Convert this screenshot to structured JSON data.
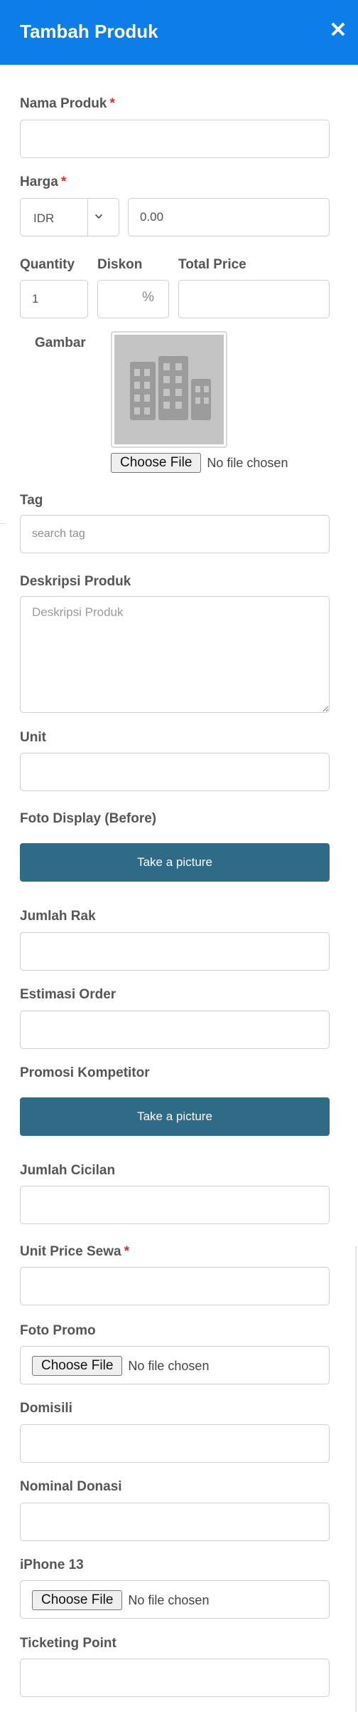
{
  "header": {
    "title": "Tambah Produk",
    "close_icon": "close-icon"
  },
  "form": {
    "nama_produk": {
      "label": "Nama Produk",
      "required_mark": "*",
      "value": ""
    },
    "harga": {
      "label": "Harga",
      "required_mark": "*",
      "currency": "IDR",
      "value": "0.00"
    },
    "quantity": {
      "label": "Quantity",
      "value": "1"
    },
    "diskon": {
      "label": "Diskon",
      "value": "",
      "suffix": "%"
    },
    "total_price": {
      "label": "Total Price",
      "value": ""
    },
    "gambar": {
      "label": "Gambar",
      "file_button": "Choose File",
      "file_status": "No file chosen",
      "placeholder_icon": "building-icon"
    },
    "tag": {
      "label": "Tag",
      "placeholder": "search tag"
    },
    "deskripsi": {
      "label": "Deskripsi Produk",
      "placeholder": "Deskripsi Produk"
    },
    "unit": {
      "label": "Unit",
      "value": ""
    },
    "foto_display": {
      "label": "Foto Display (Before)",
      "button": "Take a picture"
    },
    "jumlah_rak": {
      "label": "Jumlah Rak",
      "value": ""
    },
    "estimasi_order": {
      "label": "Estimasi Order",
      "value": ""
    },
    "promosi_kompetitor": {
      "label": "Promosi Kompetitor",
      "button": "Take a picture"
    },
    "jumlah_cicilan": {
      "label": "Jumlah Cicilan",
      "value": ""
    },
    "unit_price_sewa": {
      "label": "Unit Price Sewa",
      "required_mark": "*",
      "value": ""
    },
    "foto_promo": {
      "label": "Foto Promo",
      "file_button": "Choose File",
      "file_status": "No file chosen"
    },
    "domisili": {
      "label": "Domisili",
      "value": ""
    },
    "nominal_donasi": {
      "label": "Nominal Donasi",
      "value": ""
    },
    "iphone13": {
      "label": "iPhone 13",
      "file_button": "Choose File",
      "file_status": "No file chosen"
    },
    "ticketing_point": {
      "label": "Ticketing Point",
      "value": ""
    }
  },
  "colors": {
    "header": "#0d7de8",
    "button": "#2f6a87",
    "required": "#e22b2b"
  }
}
